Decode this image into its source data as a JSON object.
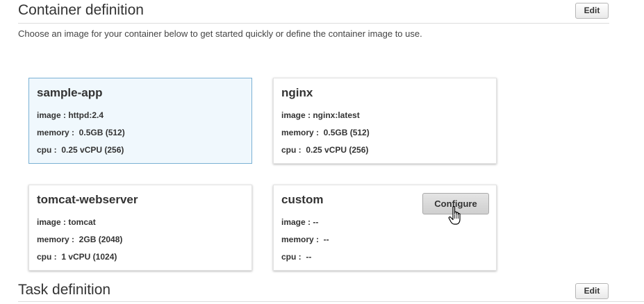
{
  "container_section": {
    "title": "Container definition",
    "edit_label": "Edit",
    "intro": "Choose an image for your container below to get started quickly or define the container image to use."
  },
  "cards": [
    {
      "name": "sample-app",
      "image": "image : httpd:2.4",
      "memory": "memory :  0.5GB (512)",
      "cpu": "cpu :  0.25 vCPU (256)",
      "selected": true
    },
    {
      "name": "nginx",
      "image": "image : nginx:latest",
      "memory": "memory :  0.5GB (512)",
      "cpu": "cpu :  0.25 vCPU (256)",
      "selected": false
    },
    {
      "name": "tomcat-webserver",
      "image": "image : tomcat",
      "memory": "memory :  2GB (2048)",
      "cpu": "cpu :  1 vCPU (1024)",
      "selected": false
    },
    {
      "name": "custom",
      "image": "image : --",
      "memory": "memory :  --",
      "cpu": "cpu :  --",
      "selected": false,
      "configure_label": "Configure"
    }
  ],
  "task_section": {
    "title": "Task definition",
    "edit_label": "Edit"
  },
  "colors": {
    "selected_card_bg": "#f0f8fd",
    "selected_card_border": "#7ab1d4"
  },
  "icons": {
    "cursor": "hand-pointer-icon"
  }
}
